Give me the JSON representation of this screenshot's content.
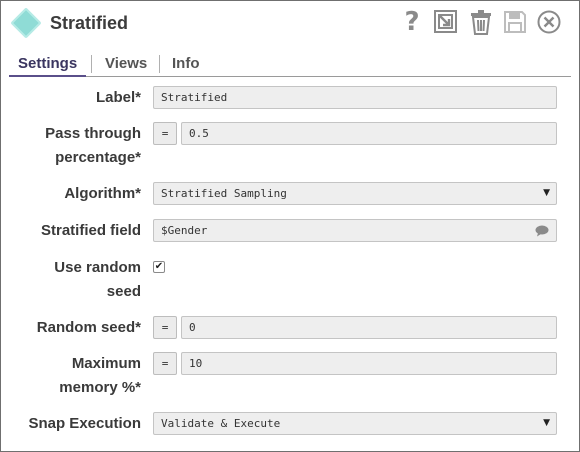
{
  "header": {
    "title": "Stratified",
    "help_label": "?",
    "icons": {
      "snap": "teal-diamond-icon",
      "expand": "expand-icon",
      "delete": "trash-icon",
      "save": "save-icon",
      "close": "close-circle-icon"
    }
  },
  "tabs": [
    {
      "label": "Settings",
      "active": true
    },
    {
      "label": "Views",
      "active": false
    },
    {
      "label": "Info",
      "active": false
    }
  ],
  "form": {
    "label_field": {
      "label": "Label*",
      "value": "Stratified"
    },
    "pass_through": {
      "label_line1": "Pass through",
      "label_line2": "percentage*",
      "eq": "=",
      "value": "0.5"
    },
    "algorithm": {
      "label": "Algorithm*",
      "value": "Stratified Sampling",
      "caret": "▼"
    },
    "stratified_field": {
      "label": "Stratified field",
      "value": "$Gender"
    },
    "use_random_seed": {
      "label_line1": "Use random",
      "label_line2": "seed",
      "checked": true,
      "check_glyph": "✔"
    },
    "random_seed": {
      "label": "Random seed*",
      "eq": "=",
      "value": "0"
    },
    "max_memory": {
      "label_line1": "Maximum",
      "label_line2": "memory %*",
      "eq": "=",
      "value": "10"
    },
    "snap_execution": {
      "label": "Snap Execution",
      "value": "Validate & Execute",
      "caret": "▼"
    }
  },
  "colors": {
    "accent": "#5a4f8a",
    "snap_icon": "#8fdcd6",
    "field_bg": "#eeeeee",
    "icon_gray": "#8a8a8a"
  }
}
